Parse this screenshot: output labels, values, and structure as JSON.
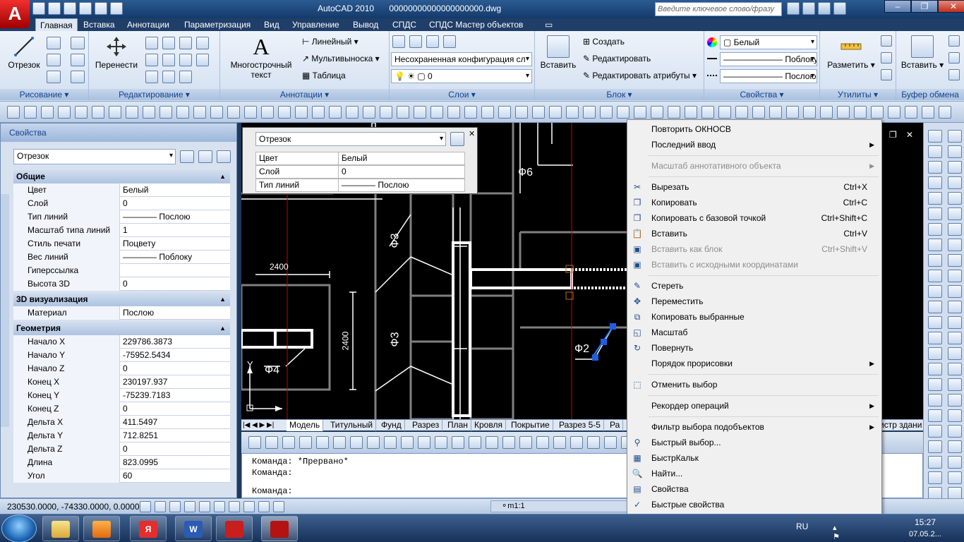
{
  "titlebar": {
    "app_title": "AutoCAD 2010",
    "file_name": "00000000000000000000.dwg",
    "search_placeholder": "Введите ключевое слово/фразу"
  },
  "ribbon_tabs": [
    "Главная",
    "Вставка",
    "Аннотации",
    "Параметризация",
    "Вид",
    "Управление",
    "Вывод",
    "СПДС",
    "СПДС Мастер объектов"
  ],
  "ribbon": {
    "draw": {
      "line": "Отрезок",
      "title": "Рисование"
    },
    "modify": {
      "move": "Перенести",
      "title": "Редактирование"
    },
    "annotation": {
      "mtext_1": "Многострочный",
      "mtext_2": "текст",
      "linear": "Линейный",
      "multileader": "Мультивыноска",
      "table": "Таблица",
      "title": "Аннотации"
    },
    "layers": {
      "state": "Несохраненная конфигурация сл",
      "current": "0",
      "title": "Слои"
    },
    "block": {
      "insert": "Вставить",
      "create": "Создать",
      "edit": "Редактировать",
      "edit_attr": "Редактировать атрибуты",
      "title": "Блок"
    },
    "properties": {
      "color": "Белый",
      "lineweight": "Поблоку",
      "linetype": "Послою",
      "title": "Свойства"
    },
    "utilities": {
      "measure": "Разметить",
      "title": "Утилиты"
    },
    "clipboard": {
      "paste": "Вставить",
      "title": "Буфер обмена"
    }
  },
  "props_palette": {
    "title": "Свойства",
    "object_type": "Отрезок",
    "general": {
      "title": "Общие",
      "rows": [
        {
          "k": "Цвет",
          "v": "Белый"
        },
        {
          "k": "Слой",
          "v": "0"
        },
        {
          "k": "Тип линий",
          "v": "———— Послою"
        },
        {
          "k": "Масштаб типа линий",
          "v": "1"
        },
        {
          "k": "Стиль печати",
          "v": "Поцвету"
        },
        {
          "k": "Вес линий",
          "v": "———— Поблоку"
        },
        {
          "k": "Гиперссылка",
          "v": ""
        },
        {
          "k": "Высота 3D",
          "v": "0"
        }
      ]
    },
    "viz3d": {
      "title": "3D визуализация",
      "rows": [
        {
          "k": "Материал",
          "v": "Послою"
        }
      ]
    },
    "geometry": {
      "title": "Геометрия",
      "rows": [
        {
          "k": "Начало X",
          "v": "229786.3873"
        },
        {
          "k": "Начало Y",
          "v": "-75952.5434"
        },
        {
          "k": "Начало Z",
          "v": "0"
        },
        {
          "k": "Конец X",
          "v": "230197.937"
        },
        {
          "k": "Конец Y",
          "v": "-75239.7183"
        },
        {
          "k": "Конец Z",
          "v": "0"
        },
        {
          "k": "Дельта X",
          "v": "411.5497"
        },
        {
          "k": "Дельта Y",
          "v": "712.8251"
        },
        {
          "k": "Дельта Z",
          "v": "0"
        },
        {
          "k": "Длина",
          "v": "823.0995"
        },
        {
          "k": "Угол",
          "v": "60"
        }
      ]
    }
  },
  "quick_props": {
    "type": "Отрезок",
    "rows": [
      {
        "k": "Цвет",
        "v": "Белый"
      },
      {
        "k": "Слой",
        "v": "0"
      },
      {
        "k": "Тип линий",
        "v": "———— Послою"
      }
    ]
  },
  "drawing_labels": {
    "f6": "Ф6",
    "f3a": "Ф3",
    "f3b": "Ф3",
    "f4": "Ф4",
    "f2": "Ф2",
    "dim1": "2400",
    "dim2": "2400",
    "y_axis": "Y"
  },
  "layout_tabs": [
    "Модель",
    "Титульный",
    "Фунд",
    "Разрез",
    "План",
    "Кровля",
    "Покрытие",
    "Разрез 5-5",
    "Ра"
  ],
  "layout_tab_right": "истр здани",
  "command_line": [
    "Команда: *Прервано*",
    "Команда:",
    "Команда:"
  ],
  "status": {
    "coords": "230530.0000, -74330.0000, 0.0000",
    "scale": "m1:1"
  },
  "context_menu": [
    {
      "label": "Повторить ОКНОСВ"
    },
    {
      "label": "Последний ввод",
      "submenu": true
    },
    {
      "sep": true
    },
    {
      "label": "Масштаб аннотативного объекта",
      "submenu": true,
      "disabled": true
    },
    {
      "sep": true
    },
    {
      "label": "Вырезать",
      "shortcut": "Ctrl+X",
      "icon": "cut-icon",
      "glyph": "✂"
    },
    {
      "label": "Копировать",
      "shortcut": "Ctrl+C",
      "icon": "copy-icon",
      "glyph": "❐"
    },
    {
      "label": "Копировать с базовой точкой",
      "shortcut": "Ctrl+Shift+C",
      "icon": "copy-base-icon",
      "glyph": "❐"
    },
    {
      "label": "Вставить",
      "shortcut": "Ctrl+V",
      "icon": "paste-icon",
      "glyph": "📋"
    },
    {
      "label": "Вставить как блок",
      "shortcut": "Ctrl+Shift+V",
      "disabled": true,
      "icon": "paste-block-icon",
      "glyph": "▣"
    },
    {
      "label": "Вставить с исходными координатами",
      "disabled": true,
      "icon": "paste-orig-icon",
      "glyph": "▣"
    },
    {
      "sep": true
    },
    {
      "label": "Стереть",
      "icon": "erase-icon",
      "glyph": "✎"
    },
    {
      "label": "Переместить",
      "icon": "move-icon",
      "glyph": "✥"
    },
    {
      "label": "Копировать выбранные",
      "icon": "copy-selection-icon",
      "glyph": "⧉"
    },
    {
      "label": "Масштаб",
      "icon": "scale-icon",
      "glyph": "◱"
    },
    {
      "label": "Повернуть",
      "icon": "rotate-icon",
      "glyph": "↻"
    },
    {
      "label": "Порядок прорисовки",
      "submenu": true
    },
    {
      "sep": true
    },
    {
      "label": "Отменить выбор",
      "icon": "deselect-icon",
      "glyph": "⬚"
    },
    {
      "sep": true
    },
    {
      "label": "Рекордер операций",
      "submenu": true
    },
    {
      "sep": true
    },
    {
      "label": "Фильтр выбора подобъектов",
      "submenu": true
    },
    {
      "label": "Быстрый выбор...",
      "icon": "quick-select-icon",
      "glyph": "⚲"
    },
    {
      "label": "БыстрКальк",
      "icon": "calculator-icon",
      "glyph": "▦"
    },
    {
      "label": "Найти...",
      "icon": "find-icon",
      "glyph": "🔍"
    },
    {
      "label": "Свойства",
      "icon": "properties-icon",
      "glyph": "▤"
    },
    {
      "label": "Быстрые свойства",
      "icon": "checkmark-icon",
      "glyph": "✓"
    }
  ],
  "tray": {
    "lang": "RU",
    "time": "15:27",
    "date": "07.05.2..."
  }
}
